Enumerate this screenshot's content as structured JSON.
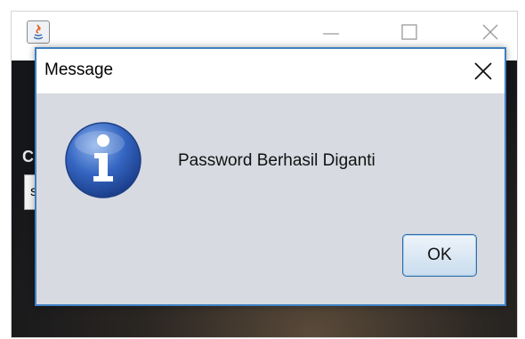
{
  "background_window": {
    "label_fragment": "C",
    "field_fragment": "s"
  },
  "dialog": {
    "title": "Message",
    "message": "Password Berhasil Diganti",
    "ok_label": "OK",
    "icon": "information-icon"
  },
  "colors": {
    "dialog_bg": "#d7dae1",
    "dialog_border": "#3e7fc1",
    "info_icon": "#2e5fb5"
  }
}
